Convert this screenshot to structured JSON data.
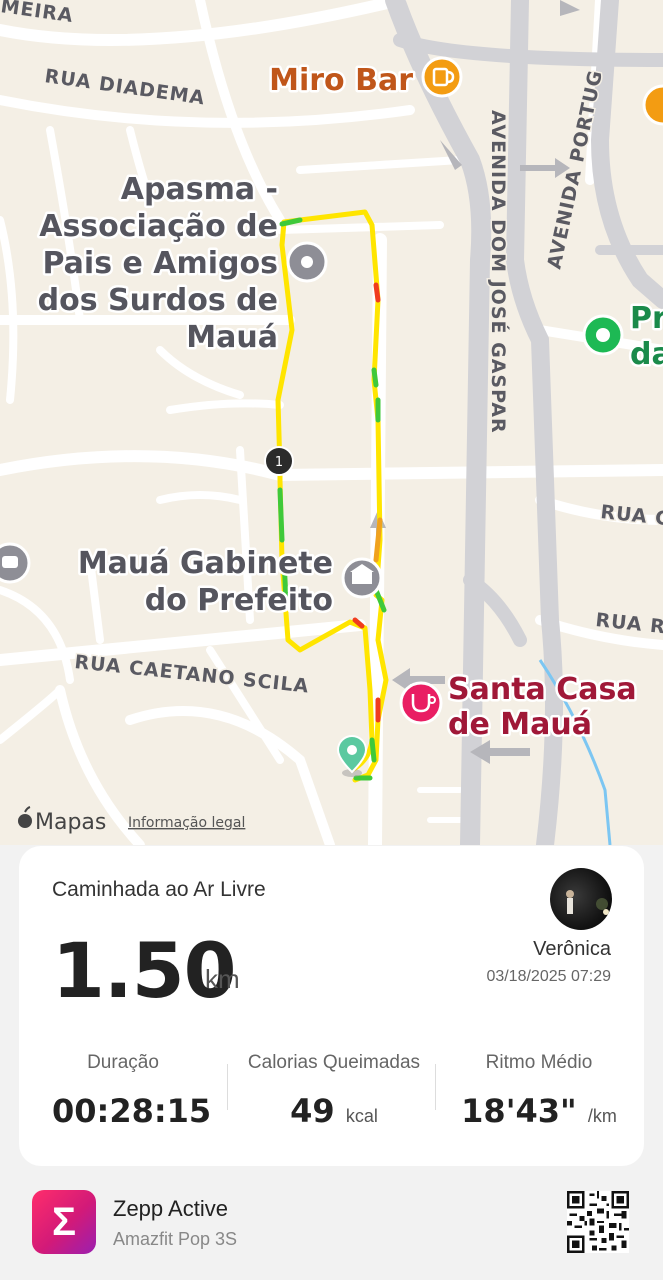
{
  "map": {
    "labels": {
      "miro_bar": "Miro Bar",
      "apasma": [
        "Apasma -",
        "Associação de",
        "Pais e Amigos",
        "dos Surdos de",
        "Mauá"
      ],
      "gabinete": [
        "Mauá Gabinete",
        "do Prefeito"
      ],
      "santa_casa": [
        "Santa Casa",
        "de Mauá"
      ],
      "partial_pr": [
        "Pr",
        "da"
      ],
      "route_marker": "1"
    },
    "streets": {
      "rua_diadema": "RUA DIADEMA",
      "avenida_dom_jose_gaspar": "AVENIDA DOM JOSÉ GASPAR",
      "avenida_portugal": "AVENIDA PORTUG",
      "rua_caetano_scila": "RUA CAETANO SCILA",
      "rua_c": "RUA C",
      "rua_r": "RUA R",
      "meira": "MEIRA"
    },
    "attribution": "Mapas",
    "legal": "Informação legal",
    "colors": {
      "bar_icon": "#f39c12",
      "hospital_icon": "#e91e63",
      "park_icon": "#1db954",
      "route_yellow": "#ffe500",
      "route_green": "#3fc93a",
      "route_red": "#f03c1e"
    }
  },
  "activity": {
    "title": "Caminhada ao Ar Livre",
    "distance": "1.50",
    "distance_unit": "km",
    "user_name": "Verônica",
    "datetime": "03/18/2025 07:29"
  },
  "stats": [
    {
      "label": "Duração",
      "value": "00:28:15",
      "unit": ""
    },
    {
      "label": "Calorias Queimadas",
      "value": "49",
      "unit": "kcal"
    },
    {
      "label": "Ritmo Médio",
      "value": "18'43\"",
      "unit": "/km"
    }
  ],
  "footer": {
    "logo_glyph": "Σ",
    "app_name": "Zepp Active",
    "device_name": "Amazfit Pop 3S"
  }
}
